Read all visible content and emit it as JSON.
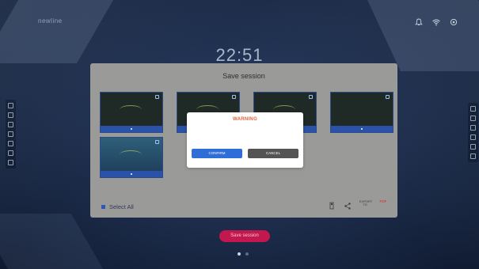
{
  "app": {
    "brand": "newline",
    "clock": "22:51"
  },
  "top_icons": [
    "bell-icon",
    "wifi-icon",
    "settings-icon"
  ],
  "panel": {
    "title": "Save session",
    "select_all_label": "Select All",
    "actions": {
      "export_label": "EXPORT TO",
      "pdf_label": "PDF"
    }
  },
  "thumbnails": [
    {
      "name": "page-1"
    },
    {
      "name": "page-2"
    },
    {
      "name": "page-3"
    },
    {
      "name": "page-4"
    },
    {
      "name": "page-5"
    }
  ],
  "dialog": {
    "title": "WARNING",
    "message": "",
    "confirm_label": "CONFIRM",
    "cancel_label": "CANCEL"
  },
  "footer": {
    "save_button_label": "Save session"
  },
  "colors": {
    "accent_blue": "#2f6ed6",
    "warning_orange": "#e2603a",
    "save_pink": "#c2184e",
    "panel_gray": "#9a9a98"
  }
}
